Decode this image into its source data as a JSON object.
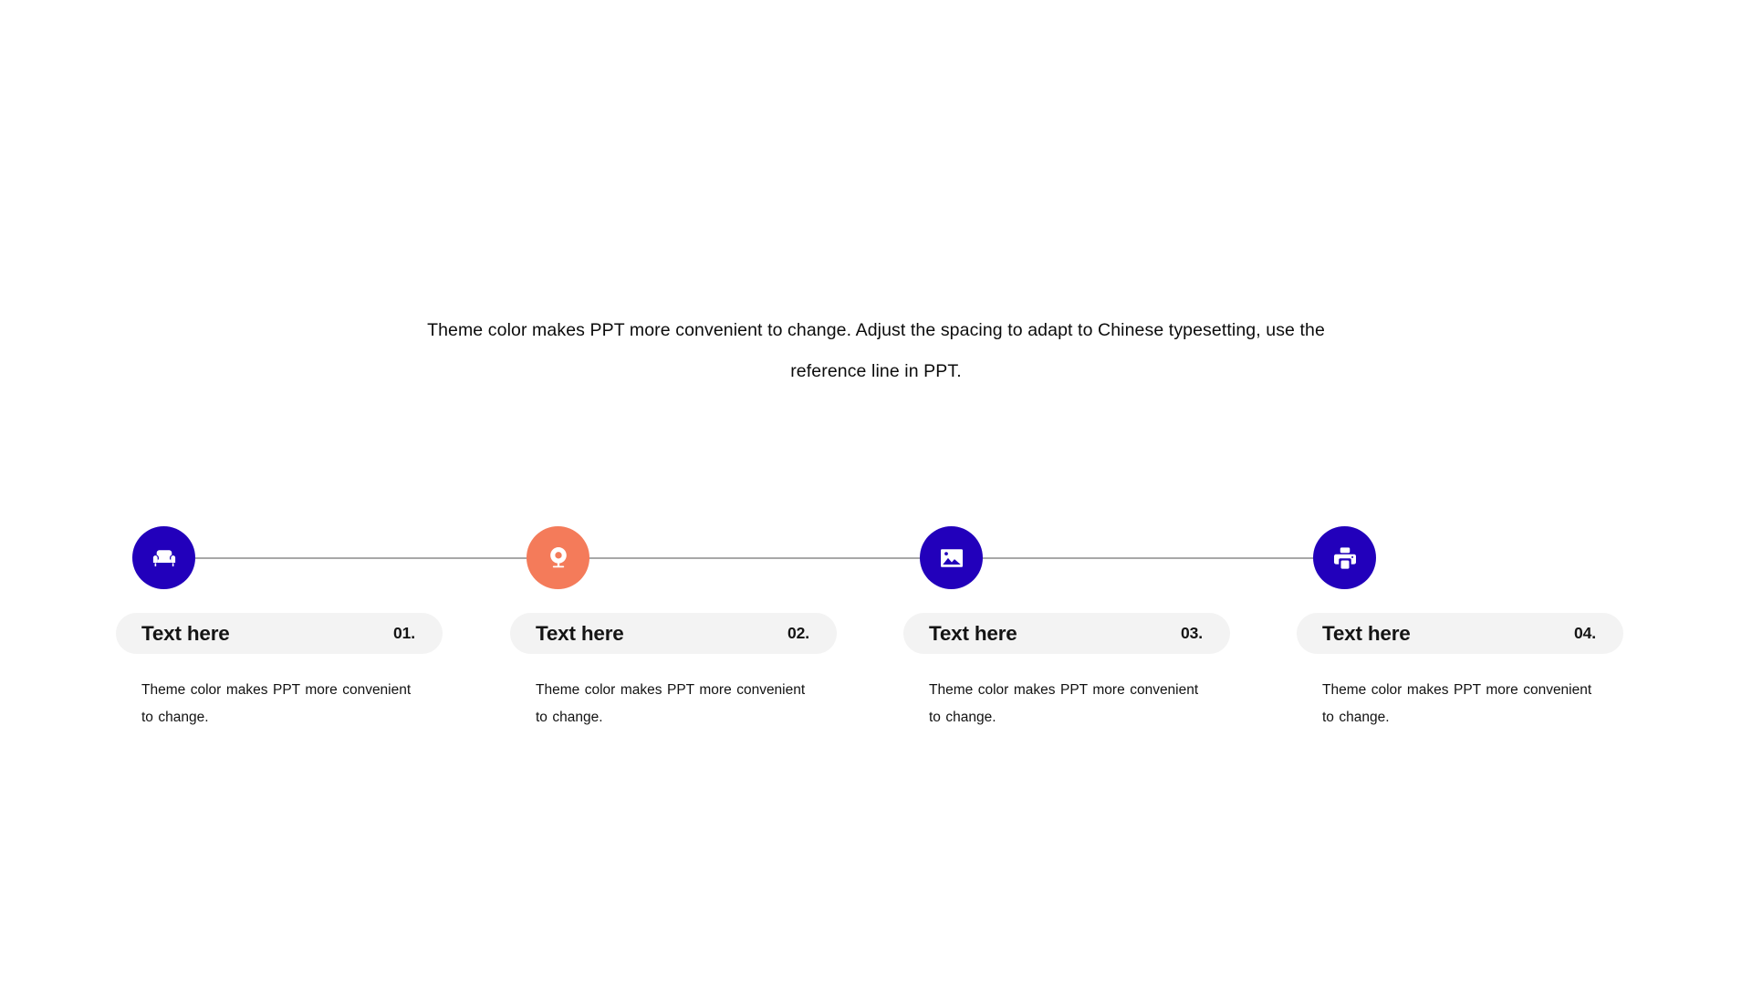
{
  "slide": {
    "intro_text": "Theme color makes PPT more convenient to change. Adjust the spacing to adapt to Chinese typesetting, use the reference line in PPT."
  },
  "colors": {
    "primary_blue": "#2200bb",
    "accent_orange": "#f47b5a",
    "pill_background": "#f3f3f3",
    "connector_line": "#a8a8a8",
    "icon_fill": "#ffffff",
    "page_background": "#ffffff"
  },
  "timeline": {
    "items": [
      {
        "icon": "armchair-icon",
        "icon_color": "#2200bb",
        "title": "Text here",
        "number": "01.",
        "description": "Theme color makes PPT more convenient to change."
      },
      {
        "icon": "webcam-icon",
        "icon_color": "#f47b5a",
        "title": "Text here",
        "number": "02.",
        "description": "Theme color makes PPT more convenient to change."
      },
      {
        "icon": "image-icon",
        "icon_color": "#2200bb",
        "title": "Text here",
        "number": "03.",
        "description": "Theme color makes PPT more convenient to change."
      },
      {
        "icon": "printer-icon",
        "icon_color": "#2200bb",
        "title": "Text here",
        "number": "04.",
        "description": "Theme color makes PPT more convenient to change."
      }
    ]
  }
}
